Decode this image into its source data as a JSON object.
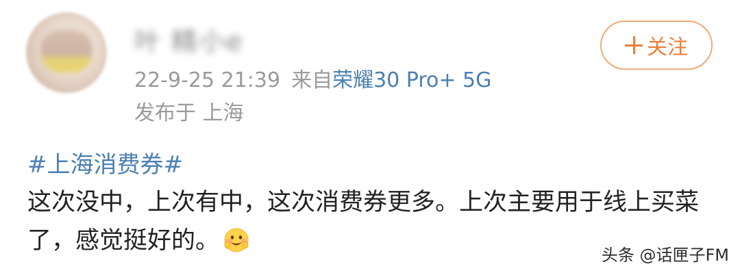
{
  "user": {
    "name": "叶 精小e",
    "avatar": "avatar-image"
  },
  "follow_button": {
    "label": "关注",
    "icon": "plus-icon"
  },
  "meta": {
    "timestamp": "22-9-25 21:39",
    "from_label": "来自",
    "device": "荣耀30 Pro+ 5G",
    "location": "发布于 上海"
  },
  "post": {
    "hashtag": "#上海消费券#",
    "text": "这次没中，上次有中，这次消费券更多。上次主要用于线上买菜了，感觉挺好的。",
    "emoji": "happy-blush-emoji-icon"
  },
  "watermark": "头条 @话匣子FM",
  "colors": {
    "link_blue": "#4a7fb1",
    "follow_orange": "#ea7f3a",
    "follow_border": "#f0a978",
    "meta_gray": "#9a9a9a",
    "text_dark": "#222222"
  }
}
